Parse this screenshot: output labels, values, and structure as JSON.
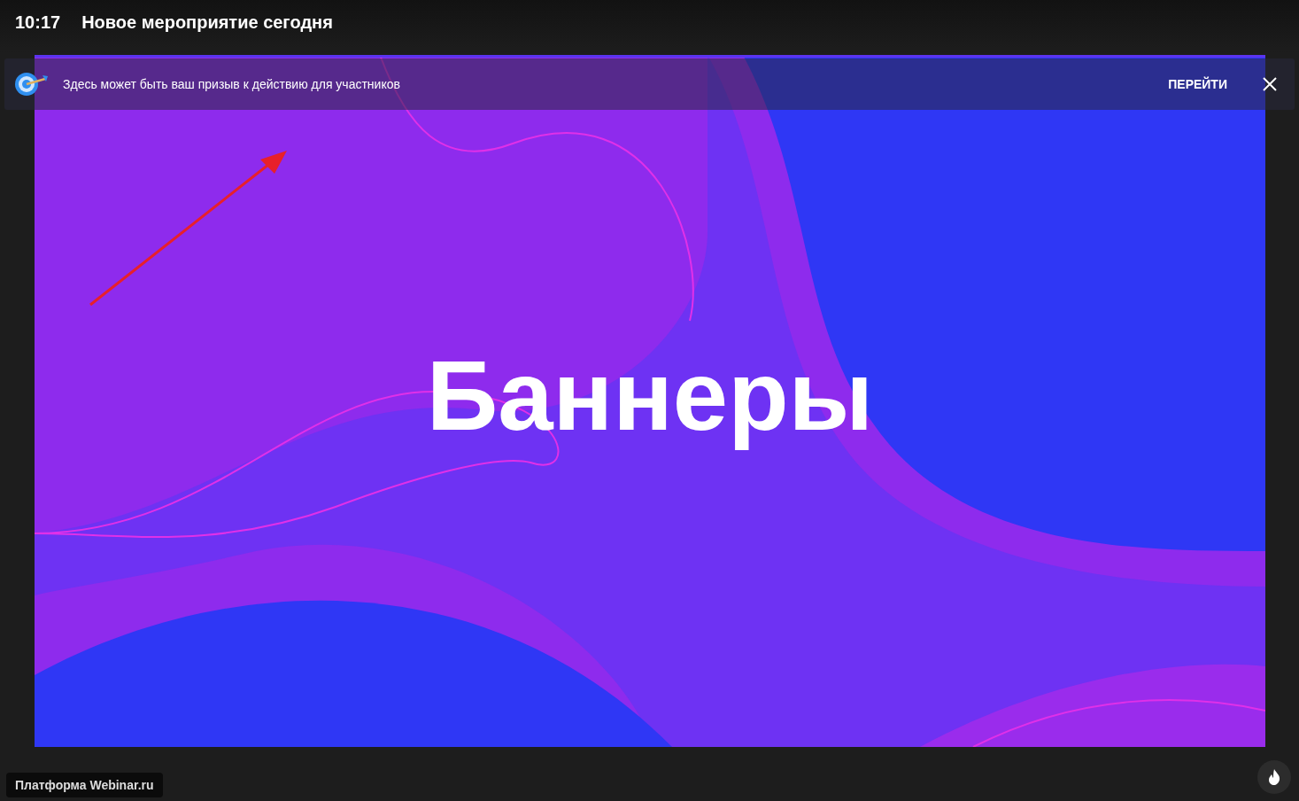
{
  "header": {
    "time": "10:17",
    "title": "Новое мероприятие сегодня"
  },
  "banner": {
    "text": "Здесь может быть ваш призыв к действию для участников",
    "action": "ПЕРЕЙТИ"
  },
  "slide": {
    "title": "Баннеры"
  },
  "footer": {
    "brand": "Платформа Webinar.ru"
  }
}
